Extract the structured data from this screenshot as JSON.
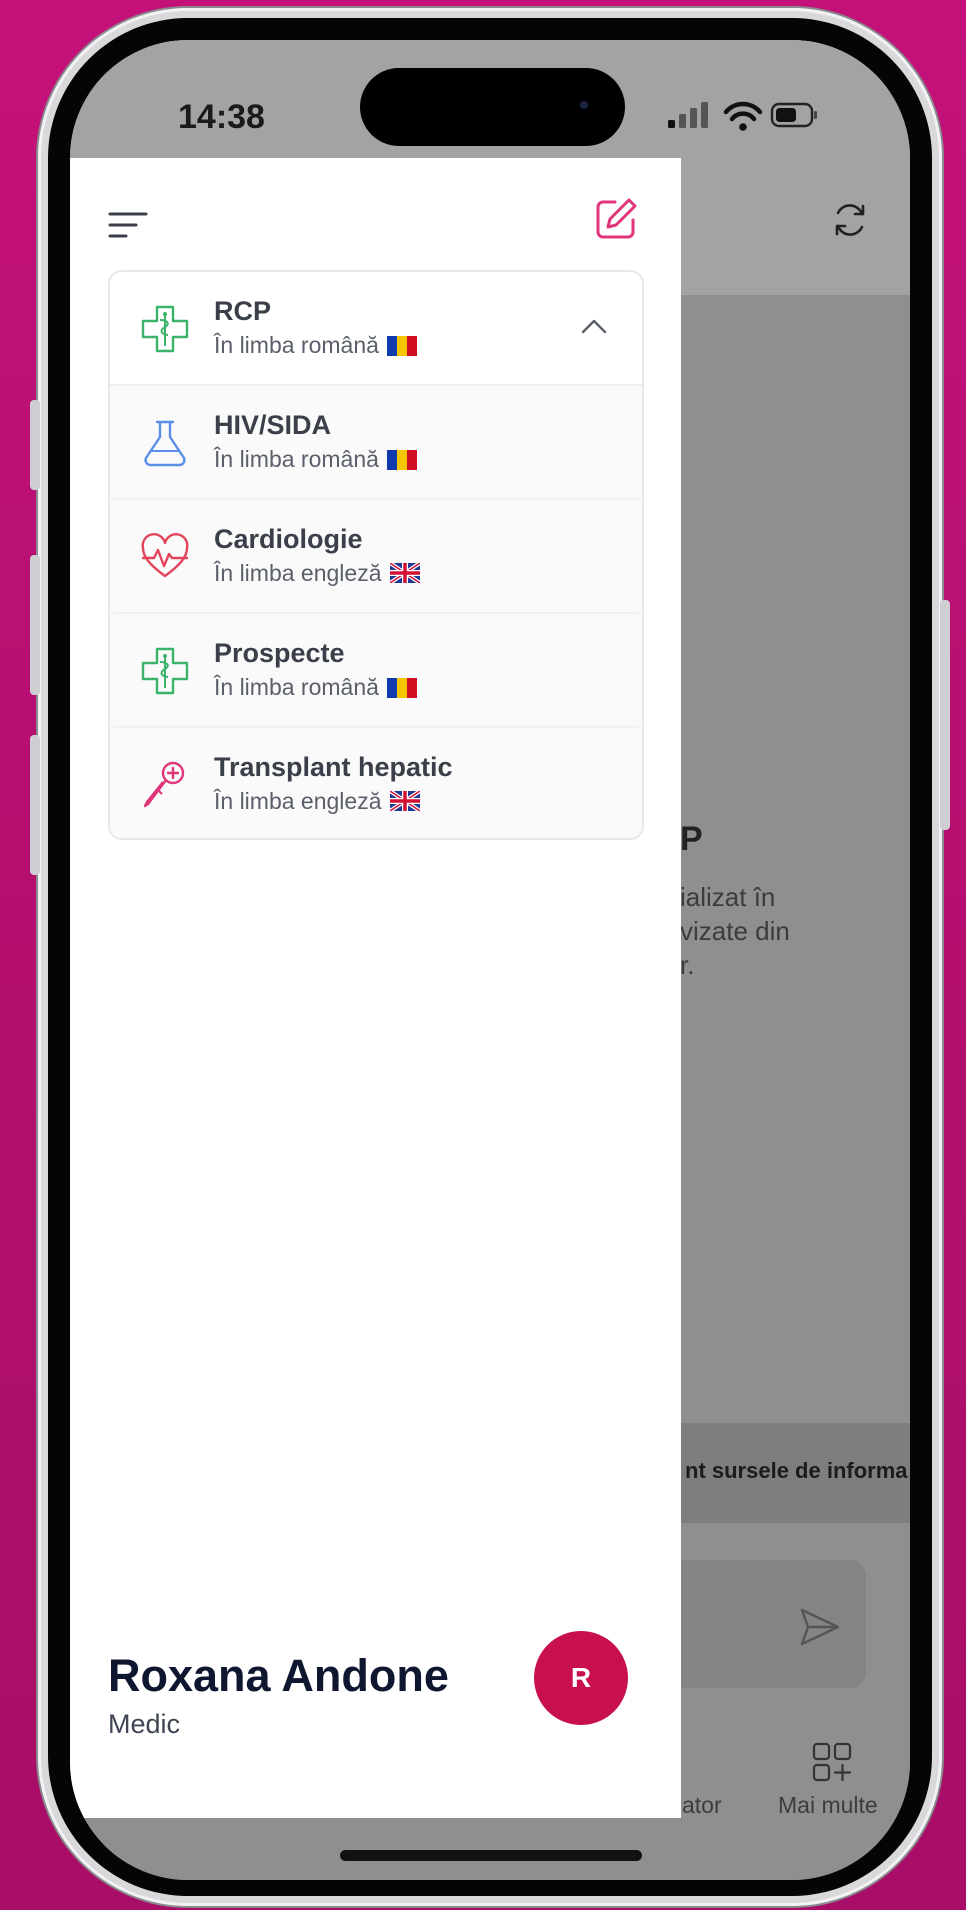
{
  "status_bar": {
    "time": "14:38"
  },
  "drawer": {
    "items": [
      {
        "title": "RCP",
        "subtitle": "În limba română",
        "flag": "romania-flag",
        "icon": "medical-cross-icon",
        "expanded": true
      },
      {
        "title": "HIV/SIDA",
        "subtitle": "În limba română",
        "flag": "romania-flag",
        "icon": "lab-flask-icon"
      },
      {
        "title": "Cardiologie",
        "subtitle": "În limba engleză",
        "flag": "uk-flag",
        "icon": "heart-pulse-icon"
      },
      {
        "title": "Prospecte",
        "subtitle": "În limba română",
        "flag": "romania-flag",
        "icon": "medical-cross-icon"
      },
      {
        "title": "Transplant hepatic",
        "subtitle": "În limba engleză",
        "flag": "uk-flag",
        "icon": "scalpel-icon"
      }
    ],
    "user": {
      "name": "Roxana Andone",
      "role": "Medic",
      "avatar_initial": "R"
    }
  },
  "background_app": {
    "title_fragment": "P",
    "text_lines": [
      "ializat în",
      "vizate din",
      "r."
    ],
    "sources_fragment": "nt sursele de informa",
    "nav": [
      {
        "label": "ator"
      },
      {
        "label": "Mai multe",
        "icon": "grid-plus-icon"
      }
    ]
  },
  "colors": {
    "background": "#c4117a",
    "accent": "#c8104f",
    "edit_icon": "#e0357a"
  }
}
